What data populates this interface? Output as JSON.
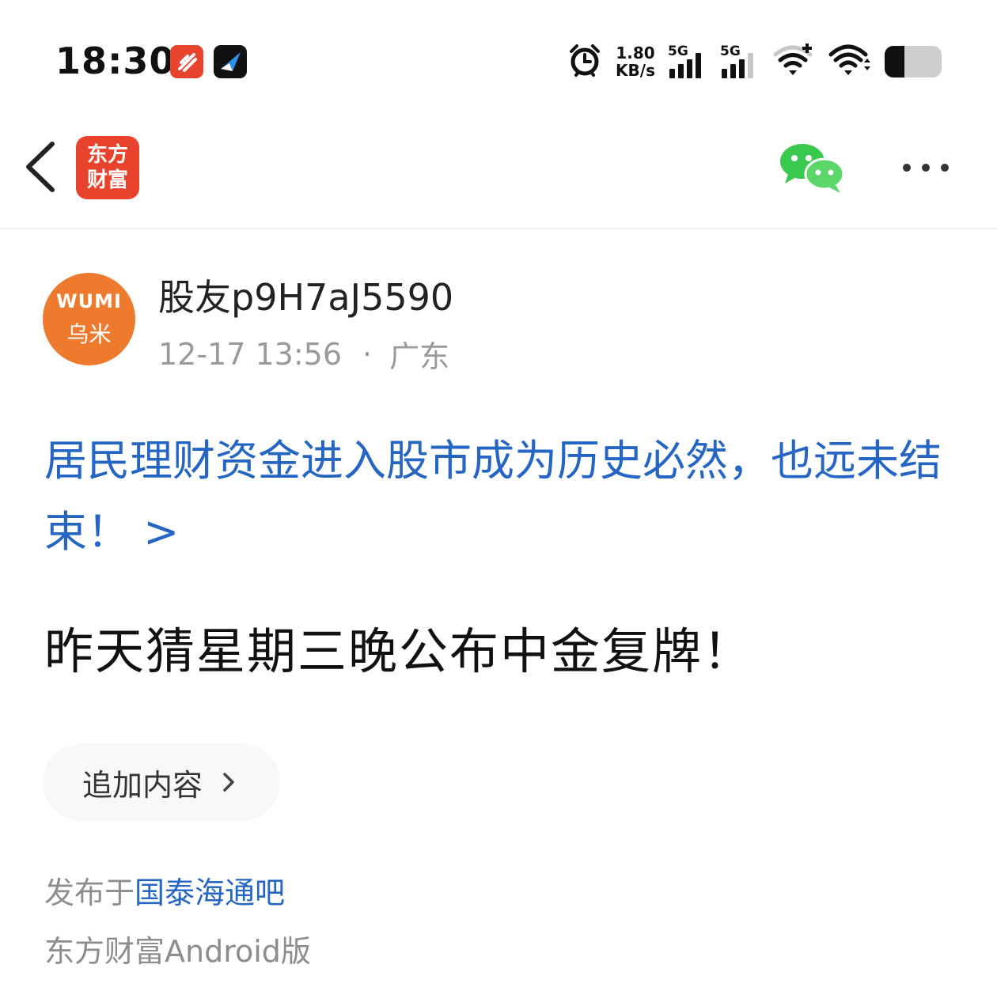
{
  "status_bar": {
    "time": "18:30",
    "net_speed_value": "1.80",
    "net_speed_unit": "KB/s",
    "sim1_label": "5G",
    "sim2_label": "5G",
    "battery_level": 0.35,
    "icons": [
      "app-red-icon",
      "app-dark-icon",
      "alarm-icon",
      "signal-icon",
      "signal-icon",
      "hotspot-icon",
      "wifi-icon",
      "battery-icon"
    ]
  },
  "header": {
    "back_icon": "chevron-left-icon",
    "logo_text": "东方财富",
    "share_icon": "wechat-icon",
    "more_icon": "more-horizontal-icon"
  },
  "author": {
    "avatar_text_top": "WUMI",
    "avatar_text_bottom": "乌米",
    "name": "股友p9H7aJ5590",
    "time": "12-17 13:56",
    "separator": "·",
    "location": "广东"
  },
  "post": {
    "linked_title": "居民理财资金进入股市成为历史必然，也远未结束！ >",
    "body": "昨天猜星期三晚公布中金复牌！",
    "append_label": "追加内容",
    "published_prefix": "发布于",
    "forum_name": "国泰海通吧",
    "platform": "东方财富Android版"
  },
  "colors": {
    "link_blue": "#2566c5",
    "brand_red": "#e8432c",
    "avatar_orange": "#ee7a2e",
    "wechat_green": "#39c94f"
  }
}
